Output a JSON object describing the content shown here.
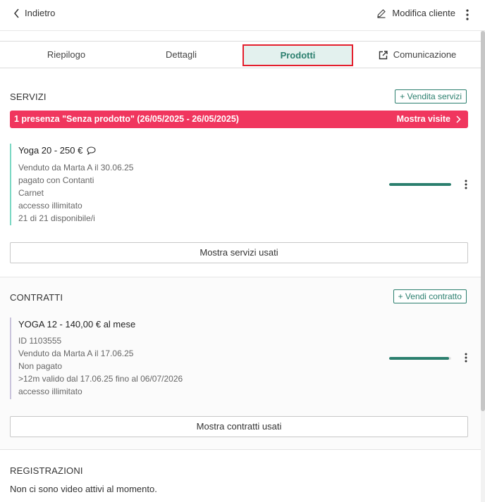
{
  "header": {
    "back_label": "Indietro",
    "edit_label": "Modifica cliente"
  },
  "tabs": [
    {
      "label": "Riepilogo"
    },
    {
      "label": "Dettagli"
    },
    {
      "label": "Prodotti",
      "active": true
    },
    {
      "label": "Comunicazione"
    }
  ],
  "servizi": {
    "title": "SERVIZI",
    "action_label": "+ Vendita servizi",
    "alert": {
      "message": "1 presenza \"Senza prodotto\" (26/05/2025 - 26/05/2025)",
      "link_label": "Mostra visite"
    },
    "card": {
      "title": "Yoga 20 - 250 €",
      "lines": [
        "Venduto da Marta A il 30.06.25",
        "pagato con Contanti",
        "Carnet",
        "accesso illimitato",
        "21 di 21 disponibile/i"
      ],
      "progress": 1.0
    },
    "show_used_label": "Mostra servizi usati"
  },
  "contratti": {
    "title": "CONTRATTI",
    "action_label": "+ Vendi contratto",
    "card": {
      "title": "YOGA 12 - 140,00 € al mese",
      "lines": [
        "ID 1103555",
        "Venduto da Marta A il 17.06.25",
        "Non pagato",
        ">12m valido dal 17.06.25 fino al 06/07/2026",
        "accesso illimitato"
      ],
      "progress": 0.97
    },
    "show_used_label": "Mostra contratti usati"
  },
  "registrazioni": {
    "title": "REGISTRAZIONI",
    "empty_message": "Non ci sono video attivi al momento."
  },
  "colors": {
    "accent": "#2b7f6e",
    "alert": "#f0365e",
    "active_tab_bg": "#e3f1ee",
    "highlight_border": "#e41f2d"
  },
  "icons": {
    "back": "chevron-left-icon",
    "edit": "pencil-icon",
    "more": "kebab-menu-icon",
    "external": "external-link-icon",
    "comment": "comment-icon",
    "chevron": "chevron-right-icon"
  }
}
